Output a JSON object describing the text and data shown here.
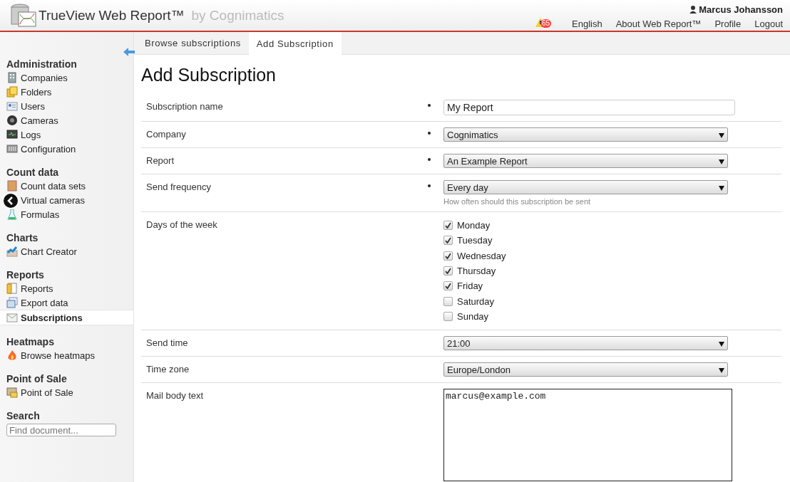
{
  "header": {
    "app_title": "TrueView Web Report™",
    "byline": "by Cognimatics",
    "user": "Marcus Johansson",
    "alert_count": "65",
    "links": [
      "English",
      "About Web Report™",
      "Profile",
      "Logout"
    ]
  },
  "sidebar": {
    "sections": [
      {
        "title": "Administration",
        "items": [
          {
            "label": "Companies",
            "selected": false
          },
          {
            "label": "Folders",
            "selected": false
          },
          {
            "label": "Users",
            "selected": false
          },
          {
            "label": "Cameras",
            "selected": false
          },
          {
            "label": "Logs",
            "selected": false
          },
          {
            "label": "Configuration",
            "selected": false
          }
        ]
      },
      {
        "title": "Count data",
        "items": [
          {
            "label": "Count data sets",
            "selected": false
          },
          {
            "label": "Virtual cameras",
            "selected": false
          },
          {
            "label": "Formulas",
            "selected": false
          }
        ]
      },
      {
        "title": "Charts",
        "items": [
          {
            "label": "Chart Creator",
            "selected": false
          }
        ]
      },
      {
        "title": "Reports",
        "items": [
          {
            "label": "Reports",
            "selected": false
          },
          {
            "label": "Export data",
            "selected": false
          },
          {
            "label": "Subscriptions",
            "selected": true
          }
        ]
      },
      {
        "title": "Heatmaps",
        "items": [
          {
            "label": "Browse heatmaps",
            "selected": false
          }
        ]
      },
      {
        "title": "Point of Sale",
        "items": [
          {
            "label": "Point of Sale",
            "selected": false
          }
        ]
      }
    ],
    "search": {
      "title": "Search",
      "placeholder": "Find document..."
    }
  },
  "tabs": [
    {
      "label": "Browse subscriptions",
      "selected": false
    },
    {
      "label": "Add Subscription",
      "selected": true
    }
  ],
  "page_title": "Add Subscription",
  "form": [
    {
      "kind": "text",
      "label": "Subscription name",
      "required": true,
      "value": "My Report"
    },
    {
      "kind": "select",
      "label": "Company",
      "required": true,
      "value": "Cognimatics"
    },
    {
      "kind": "select",
      "label": "Report",
      "required": true,
      "value": "An Example Report"
    },
    {
      "kind": "select",
      "label": "Send frequency",
      "required": true,
      "value": "Every day",
      "help": "How often should this subscription be sent"
    },
    {
      "kind": "checkboxes",
      "label": "Days of the week",
      "required": false,
      "options": [
        {
          "label": "Monday",
          "checked": true
        },
        {
          "label": "Tuesday",
          "checked": true
        },
        {
          "label": "Wednesday",
          "checked": true
        },
        {
          "label": "Thursday",
          "checked": true
        },
        {
          "label": "Friday",
          "checked": true
        },
        {
          "label": "Saturday",
          "checked": false
        },
        {
          "label": "Sunday",
          "checked": false
        }
      ]
    },
    {
      "kind": "select",
      "label": "Send time",
      "required": false,
      "value": "21:00"
    },
    {
      "kind": "select",
      "label": "Time zone",
      "required": false,
      "value": "Europe/London"
    },
    {
      "kind": "textarea",
      "label": "Mail body text",
      "required": false,
      "value": "marcus@example.com"
    }
  ]
}
